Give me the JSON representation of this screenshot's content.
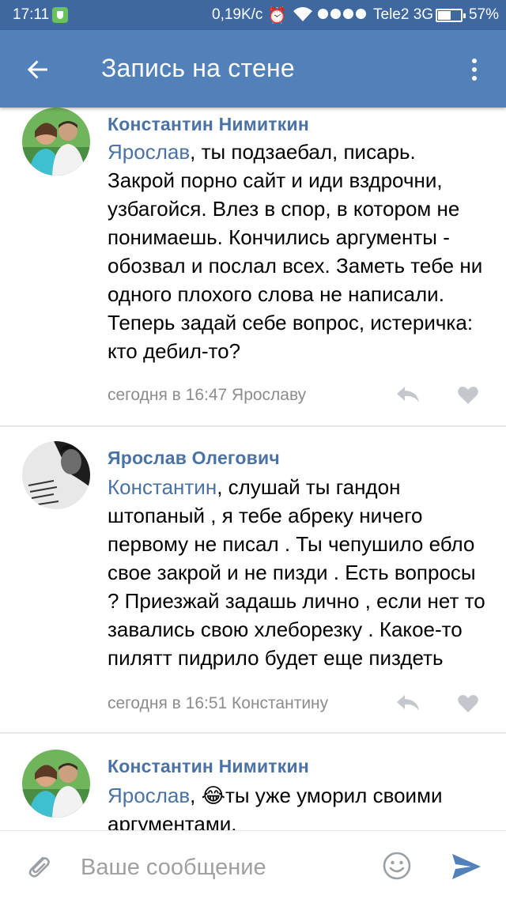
{
  "status_bar": {
    "time": "17:11",
    "speed": "0,19K/c",
    "carrier": "Tele2 3G",
    "battery": "57%"
  },
  "header": {
    "title": "Запись на стене",
    "back_icon": "arrow-left-icon",
    "menu_icon": "more-vertical-icon"
  },
  "comments": [
    {
      "author": "Константин Нимиткин",
      "mention": "Ярослав",
      "text": ", ты подзаебал, писарь. Закрой порно сайт и иди вздрочни, узбагойся. Влез в спор, в котором не понимаешь. Кончились аргументы - обозвал и послал всех. Заметь тебе ни одного плохого слова не написали. Теперь задай себе вопрос, истеричка: кто дебил-то?",
      "meta": "сегодня в 16:47 Ярославу"
    },
    {
      "author": "Ярослав Олегович",
      "mention": "Константин",
      "text": ", слушай ты гандон штопаный , я тебе абреку ничего первому не писал . Ты чепушило ебло свое закрой и не пизди . Есть вопросы ? Приезжай задашь лично , если нет то завались свою хлеборезку . Какое-то пилятт пидрило будет еще пиздеть",
      "meta": "сегодня в 16:51 Константину"
    },
    {
      "author": "Константин Нимиткин",
      "mention": "Ярослав",
      "text": ", 😂ты уже уморил своими аргументами.",
      "meta": ""
    }
  ],
  "composer": {
    "placeholder": "Ваше сообщение"
  },
  "colors": {
    "status_bar": "#3f68a0",
    "app_bar": "#5181b8",
    "link": "#4a72a5",
    "meta": "#8c8c8c"
  }
}
